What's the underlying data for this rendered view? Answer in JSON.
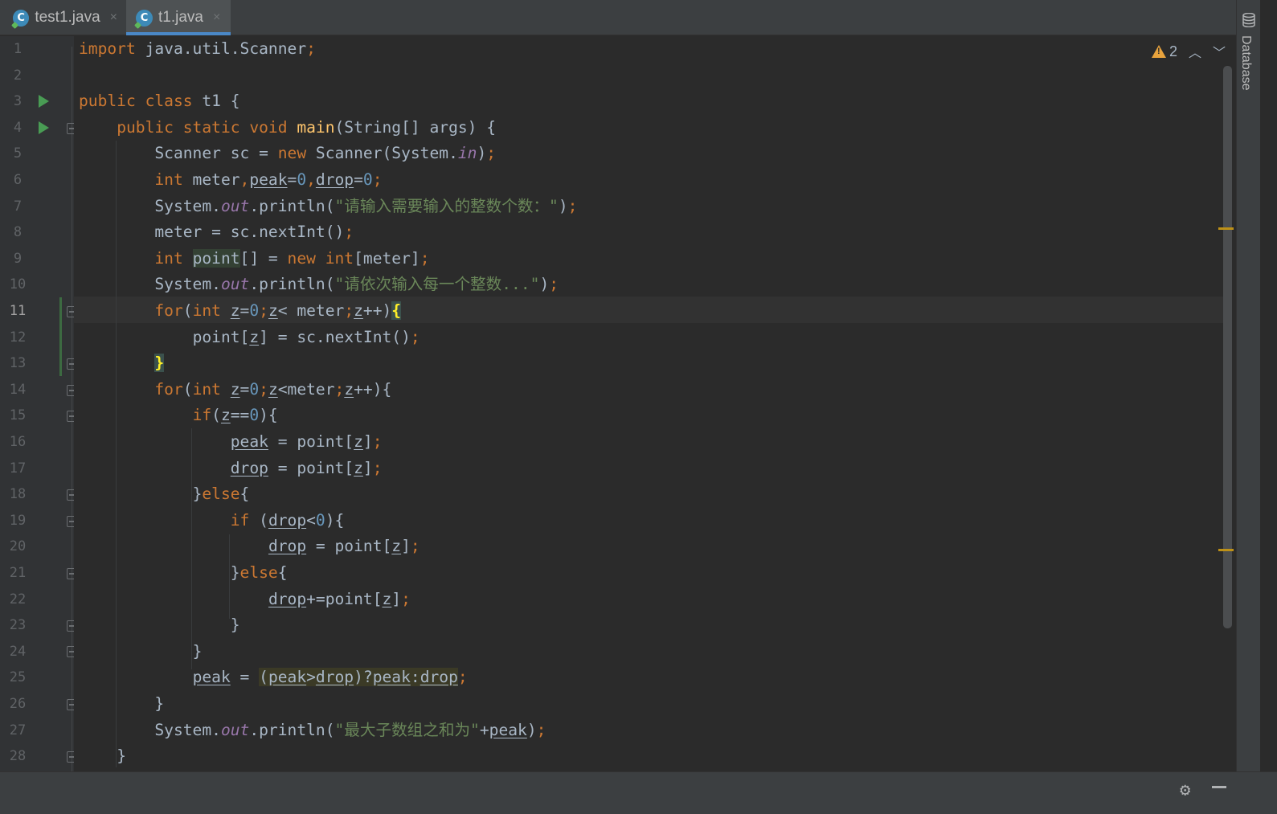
{
  "tabs": [
    {
      "label": "test1.java",
      "icon": "java-class-icon",
      "close": "×",
      "active": false
    },
    {
      "label": "t1.java",
      "icon": "java-class-icon",
      "close": "×",
      "active": true
    }
  ],
  "tool_window": {
    "label": "Database",
    "icon": "database-icon"
  },
  "inspection": {
    "warning_count": "2",
    "up": "⌃",
    "down": "⌄"
  },
  "gutter": {
    "line_numbers": [
      "1",
      "2",
      "3",
      "4",
      "5",
      "6",
      "7",
      "8",
      "9",
      "10",
      "11",
      "12",
      "13",
      "14",
      "15",
      "16",
      "17",
      "18",
      "19",
      "20",
      "21",
      "22",
      "23",
      "24",
      "25",
      "26",
      "27",
      "28"
    ],
    "current_line": "11"
  },
  "code": {
    "l1": {
      "kw": "import",
      "rest": " java.util.Scanner",
      "semi": ";"
    },
    "l3": {
      "kw": "public class",
      "rest": " t1 {"
    },
    "l4": {
      "kw": "public static void",
      "fn": "main",
      "rest": "(String[] args) {"
    },
    "l5": {
      "a": "Scanner sc = ",
      "kw": "new",
      "b": " Scanner(System.",
      "fld": "in",
      "c": ")",
      "semi": ";"
    },
    "l6": {
      "kw": "int",
      "a": " meter",
      "comma1": ",",
      "v1": "peak",
      "eq1": "=",
      "n1": "0",
      "comma2": ",",
      "v2": "drop",
      "eq2": "=",
      "n2": "0",
      "semi": ";"
    },
    "l7": {
      "a": "System.",
      "fld": "out",
      "b": ".println(",
      "str": "\"请输入需要输入的整数个数：\"",
      "c": ")",
      "semi": ";"
    },
    "l8": {
      "a": "meter = sc.nextInt()",
      "semi": ";"
    },
    "l9": {
      "kw": "int",
      "sp": " ",
      "var": "point",
      "a": "[] = ",
      "kw2": "new",
      "sp2": " ",
      "kw3": "int",
      "b": "[meter]",
      "semi": ";"
    },
    "l10": {
      "a": "System.",
      "fld": "out",
      "b": ".println(",
      "str": "\"请依次输入每一个整数...\"",
      "c": ")",
      "semi": ";"
    },
    "l11": {
      "kw": "for",
      "a": "(",
      "kw2": "int",
      "sp": " ",
      "z1": "z",
      "eq": "=",
      "n": "0",
      "s1": ";",
      "z2": "z",
      "b": "< meter",
      "s2": ";",
      "z3": "z",
      "c": "++)",
      "brace": "{"
    },
    "l12": {
      "a": "point[",
      "z": "z",
      "b": "] = sc.nextInt()",
      "semi": ";"
    },
    "l13": {
      "brace": "}"
    },
    "l14": {
      "kw": "for",
      "a": "(",
      "kw2": "int",
      "sp": " ",
      "z1": "z",
      "eq": "=",
      "n": "0",
      "s1": ";",
      "z2": "z",
      "b": "<meter",
      "s2": ";",
      "z3": "z",
      "c": "++){"
    },
    "l15": {
      "kw": "if",
      "a": "(",
      "z": "z",
      "b": "==",
      "n": "0",
      "c": "){"
    },
    "l16": {
      "v": "peak",
      "a": " = point[",
      "z": "z",
      "b": "]",
      "semi": ";"
    },
    "l17": {
      "v": "drop",
      "a": " = point[",
      "z": "z",
      "b": "]",
      "semi": ";"
    },
    "l18": {
      "a": "}",
      "kw": "else",
      "b": "{"
    },
    "l19": {
      "kw": "if",
      "a": " (",
      "v": "drop",
      "b": "<",
      "n": "0",
      "c": "){"
    },
    "l20": {
      "v": "drop",
      "a": " = point[",
      "z": "z",
      "b": "]",
      "semi": ";"
    },
    "l21": {
      "a": "}",
      "kw": "else",
      "b": "{"
    },
    "l22": {
      "v": "drop",
      "a": "+=point[",
      "z": "z",
      "b": "]",
      "semi": ";"
    },
    "l23": {
      "a": "}"
    },
    "l24": {
      "a": "}"
    },
    "l25": {
      "v": "peak",
      "a": " = ",
      "p1": "(",
      "v1": "peak",
      "gt": ">",
      "v2": "drop",
      "p2": ")?",
      "v3": "peak",
      "col": ":",
      "v4": "drop",
      "semi": ";"
    },
    "l26": {
      "a": "}"
    },
    "l27": {
      "a": "System.",
      "fld": "out",
      "b": ".println(",
      "str": "\"最大子数组之和为\"",
      "c": "+",
      "v": "peak",
      "d": ")",
      "semi": ";"
    },
    "l28": {
      "a": "}"
    }
  },
  "status": {
    "settings_icon": "gear-icon",
    "hide_icon": "minimize-icon"
  }
}
